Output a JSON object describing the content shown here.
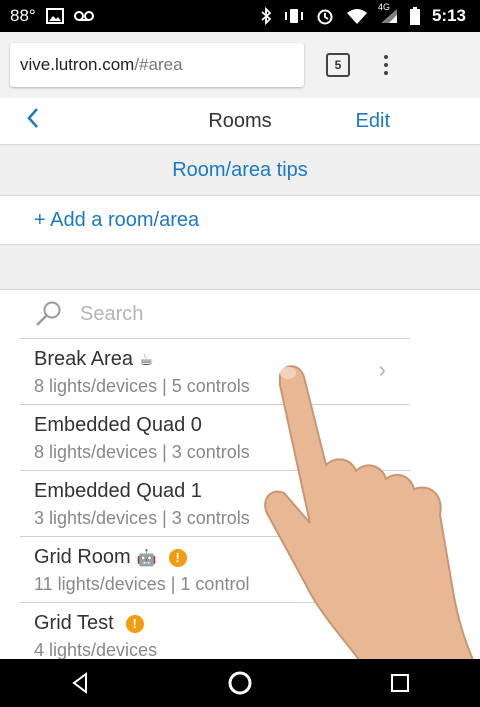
{
  "status_bar": {
    "temperature": "88°",
    "time": "5:13",
    "network": "4G",
    "icons": [
      "image-icon",
      "voicemail-icon",
      "bluetooth-icon",
      "vibrate-icon",
      "alarm-icon",
      "wifi-icon",
      "signal-icon",
      "battery-icon"
    ]
  },
  "browser": {
    "url_host": "vive.lutron.com",
    "url_path": "/#area",
    "tab_count": "5"
  },
  "header": {
    "title": "Rooms",
    "edit_label": "Edit",
    "back_label": "<"
  },
  "tips_label": "Room/area tips",
  "add_room_label": "+ Add a room/area",
  "search": {
    "placeholder": "Search"
  },
  "rooms": [
    {
      "name": "Break Area",
      "details": "8 lights/devices | 5 controls",
      "emoji": "☕",
      "warning": false
    },
    {
      "name": "Embedded Quad 0",
      "details": "8 lights/devices | 3 controls",
      "emoji": "",
      "warning": false
    },
    {
      "name": "Embedded Quad 1",
      "details": "3 lights/devices | 3 controls",
      "emoji": "",
      "warning": false
    },
    {
      "name": "Grid Room",
      "details": "11 lights/devices | 1 control",
      "emoji": "🤖",
      "warning": true
    },
    {
      "name": "Grid Test",
      "details": "4 lights/devices",
      "emoji": "",
      "warning": true
    }
  ],
  "warning_glyph": "!",
  "chevron_glyph": "›",
  "colors": {
    "accent": "#1a7ac7",
    "warning": "#f39c12"
  }
}
